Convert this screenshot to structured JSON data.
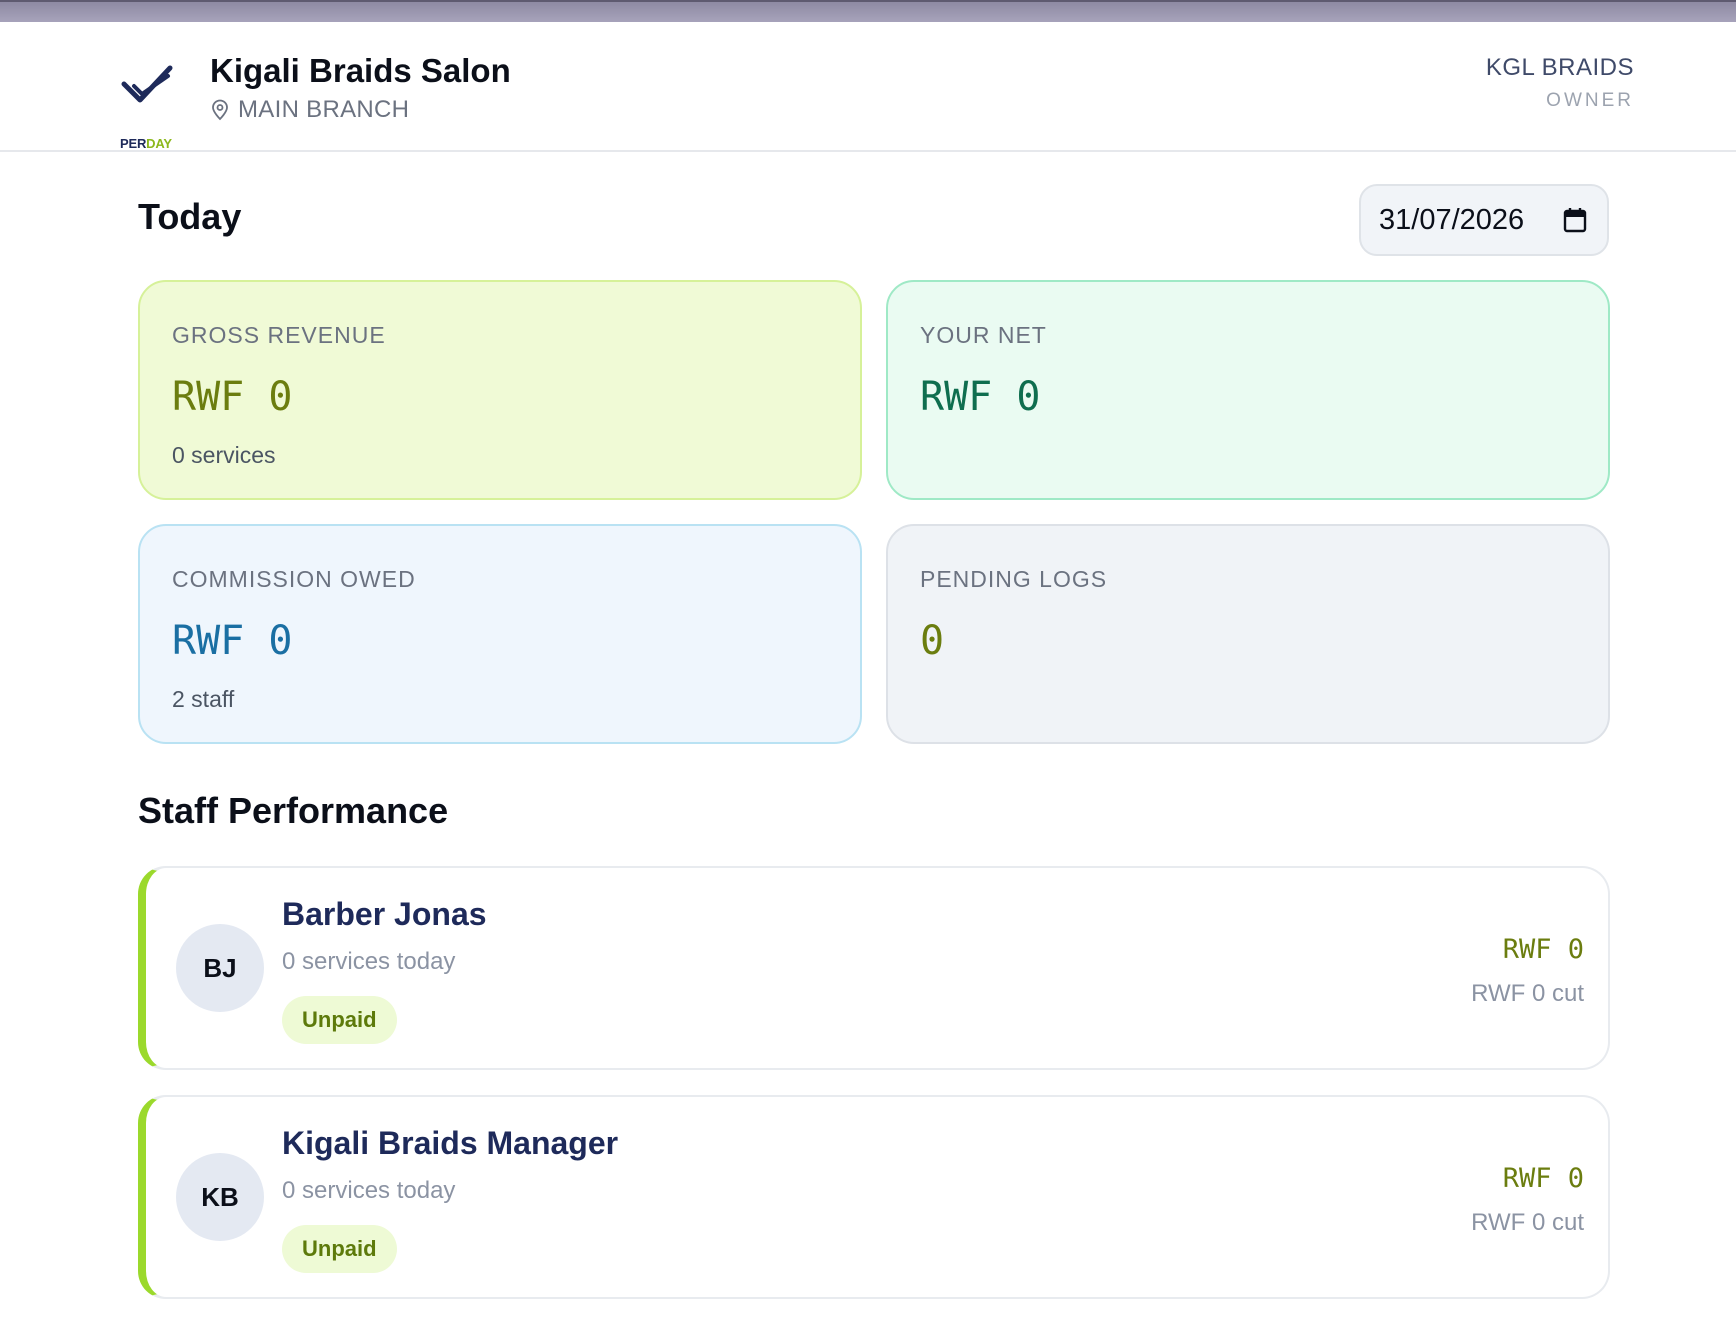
{
  "header": {
    "logo": {
      "per": "PER",
      "day": "DAY"
    },
    "org_name": "Kigali Braids Salon",
    "branch": "MAIN BRANCH",
    "user_name": "KGL BRAIDS",
    "user_role": "OWNER"
  },
  "today": {
    "title": "Today",
    "date": "31/07/2026"
  },
  "cards": {
    "gross": {
      "label": "GROSS REVENUE",
      "value": "RWF 0",
      "sub": "0 services"
    },
    "net": {
      "label": "YOUR NET",
      "value": "RWF 0"
    },
    "commission": {
      "label": "COMMISSION OWED",
      "value": "RWF 0",
      "sub": "2 staff"
    },
    "pending": {
      "label": "PENDING LOGS",
      "value": "0"
    }
  },
  "staff_section": {
    "title": "Staff Performance",
    "staff": [
      {
        "initials": "BJ",
        "name": "Barber Jonas",
        "sub": "0 services today",
        "status": "Unpaid",
        "amount": "RWF 0",
        "cut": "RWF 0 cut"
      },
      {
        "initials": "KB",
        "name": "Kigali Braids Manager",
        "sub": "0 services today",
        "status": "Unpaid",
        "amount": "RWF 0",
        "cut": "RWF 0 cut"
      }
    ]
  },
  "colors": {
    "accent_green": "#9bd92c",
    "navy": "#1e2a5a",
    "revenue_text": "#6b7d0f",
    "net_text": "#0f6e4f",
    "commission_text": "#1a6fa3"
  },
  "icons": {
    "logo": "double-check-icon",
    "location": "map-pin-icon",
    "date": "calendar-icon"
  }
}
